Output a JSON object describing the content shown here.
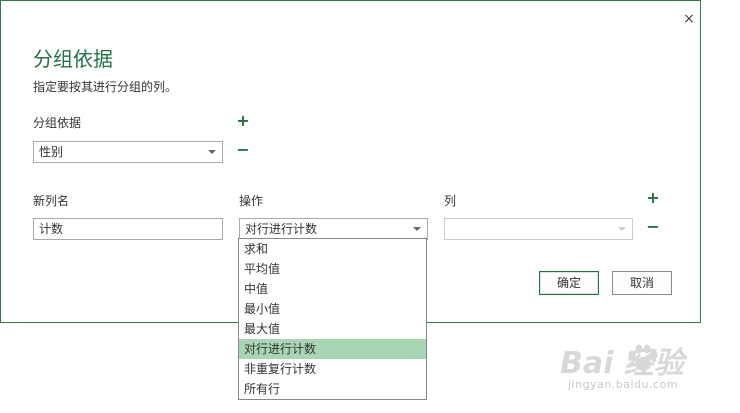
{
  "dialog": {
    "close_glyph": "×",
    "title": "分组依据",
    "subtitle": "指定要按其进行分组的列。",
    "group_by_label": "分组依据",
    "group_by_value": "性别",
    "plus_glyph": "+",
    "minus_glyph": "−",
    "columns": {
      "new_col_header": "新列名",
      "operation_header": "操作",
      "column_header": "列"
    },
    "new_col_value": "计数",
    "operation_value": "对行进行计数",
    "column_value": "",
    "ok_label": "确定",
    "cancel_label": "取消"
  },
  "operation_dropdown": {
    "options": [
      "求和",
      "平均值",
      "中值",
      "最小值",
      "最大值",
      "对行进行计数",
      "非重复行计数",
      "所有行"
    ],
    "selected_index": 5
  },
  "watermark": {
    "main": "Bai  经验",
    "sub": "jingyan.baidu.com"
  },
  "colors": {
    "accent": "#217346",
    "border": "#2f7a4a",
    "selected_option": "#a8d6b5"
  }
}
